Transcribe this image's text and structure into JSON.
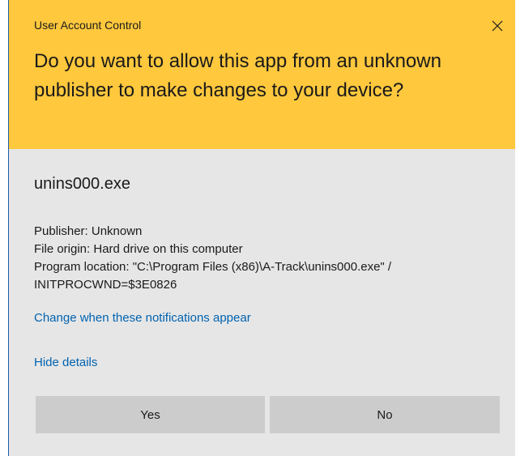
{
  "dialog": {
    "window_title": "User Account Control",
    "close_icon": "close-icon",
    "headline": "Do you want to allow this app from an unknown publisher to make changes to your device?",
    "app_name": "unins000.exe",
    "publisher": "Publisher: Unknown",
    "file_origin": "File origin: Hard drive on this computer",
    "program_location_line1": "Program location: \"C:\\Program Files (x86)\\A-Track\\unins000.exe\" /",
    "program_location_line2": "INITPROCWND=$3E0826",
    "change_link": "Change when these notifications appear",
    "hide_details_link": "Hide details",
    "yes_label": "Yes",
    "no_label": "No"
  },
  "colors": {
    "header_background": "#ffc83d",
    "body_background": "#e6e6e6",
    "link": "#0063b1",
    "button": "#cccccc"
  }
}
